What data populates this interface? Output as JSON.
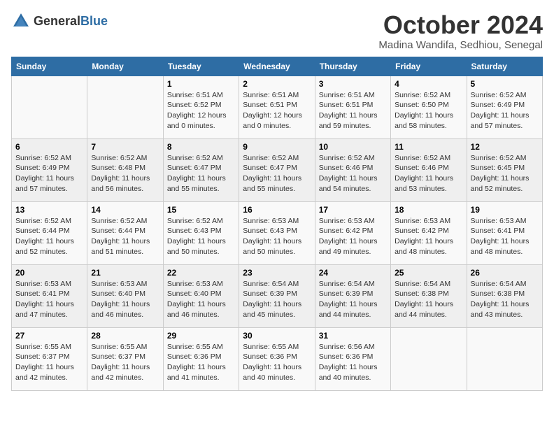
{
  "logo": {
    "general": "General",
    "blue": "Blue"
  },
  "title": "October 2024",
  "location": "Madina Wandifa, Sedhiou, Senegal",
  "weekdays": [
    "Sunday",
    "Monday",
    "Tuesday",
    "Wednesday",
    "Thursday",
    "Friday",
    "Saturday"
  ],
  "weeks": [
    [
      {
        "day": "",
        "content": ""
      },
      {
        "day": "",
        "content": ""
      },
      {
        "day": "1",
        "content": "Sunrise: 6:51 AM\nSunset: 6:52 PM\nDaylight: 12 hours\nand 0 minutes."
      },
      {
        "day": "2",
        "content": "Sunrise: 6:51 AM\nSunset: 6:51 PM\nDaylight: 12 hours\nand 0 minutes."
      },
      {
        "day": "3",
        "content": "Sunrise: 6:51 AM\nSunset: 6:51 PM\nDaylight: 11 hours\nand 59 minutes."
      },
      {
        "day": "4",
        "content": "Sunrise: 6:52 AM\nSunset: 6:50 PM\nDaylight: 11 hours\nand 58 minutes."
      },
      {
        "day": "5",
        "content": "Sunrise: 6:52 AM\nSunset: 6:49 PM\nDaylight: 11 hours\nand 57 minutes."
      }
    ],
    [
      {
        "day": "6",
        "content": "Sunrise: 6:52 AM\nSunset: 6:49 PM\nDaylight: 11 hours\nand 57 minutes."
      },
      {
        "day": "7",
        "content": "Sunrise: 6:52 AM\nSunset: 6:48 PM\nDaylight: 11 hours\nand 56 minutes."
      },
      {
        "day": "8",
        "content": "Sunrise: 6:52 AM\nSunset: 6:47 PM\nDaylight: 11 hours\nand 55 minutes."
      },
      {
        "day": "9",
        "content": "Sunrise: 6:52 AM\nSunset: 6:47 PM\nDaylight: 11 hours\nand 55 minutes."
      },
      {
        "day": "10",
        "content": "Sunrise: 6:52 AM\nSunset: 6:46 PM\nDaylight: 11 hours\nand 54 minutes."
      },
      {
        "day": "11",
        "content": "Sunrise: 6:52 AM\nSunset: 6:46 PM\nDaylight: 11 hours\nand 53 minutes."
      },
      {
        "day": "12",
        "content": "Sunrise: 6:52 AM\nSunset: 6:45 PM\nDaylight: 11 hours\nand 52 minutes."
      }
    ],
    [
      {
        "day": "13",
        "content": "Sunrise: 6:52 AM\nSunset: 6:44 PM\nDaylight: 11 hours\nand 52 minutes."
      },
      {
        "day": "14",
        "content": "Sunrise: 6:52 AM\nSunset: 6:44 PM\nDaylight: 11 hours\nand 51 minutes."
      },
      {
        "day": "15",
        "content": "Sunrise: 6:52 AM\nSunset: 6:43 PM\nDaylight: 11 hours\nand 50 minutes."
      },
      {
        "day": "16",
        "content": "Sunrise: 6:53 AM\nSunset: 6:43 PM\nDaylight: 11 hours\nand 50 minutes."
      },
      {
        "day": "17",
        "content": "Sunrise: 6:53 AM\nSunset: 6:42 PM\nDaylight: 11 hours\nand 49 minutes."
      },
      {
        "day": "18",
        "content": "Sunrise: 6:53 AM\nSunset: 6:42 PM\nDaylight: 11 hours\nand 48 minutes."
      },
      {
        "day": "19",
        "content": "Sunrise: 6:53 AM\nSunset: 6:41 PM\nDaylight: 11 hours\nand 48 minutes."
      }
    ],
    [
      {
        "day": "20",
        "content": "Sunrise: 6:53 AM\nSunset: 6:41 PM\nDaylight: 11 hours\nand 47 minutes."
      },
      {
        "day": "21",
        "content": "Sunrise: 6:53 AM\nSunset: 6:40 PM\nDaylight: 11 hours\nand 46 minutes."
      },
      {
        "day": "22",
        "content": "Sunrise: 6:53 AM\nSunset: 6:40 PM\nDaylight: 11 hours\nand 46 minutes."
      },
      {
        "day": "23",
        "content": "Sunrise: 6:54 AM\nSunset: 6:39 PM\nDaylight: 11 hours\nand 45 minutes."
      },
      {
        "day": "24",
        "content": "Sunrise: 6:54 AM\nSunset: 6:39 PM\nDaylight: 11 hours\nand 44 minutes."
      },
      {
        "day": "25",
        "content": "Sunrise: 6:54 AM\nSunset: 6:38 PM\nDaylight: 11 hours\nand 44 minutes."
      },
      {
        "day": "26",
        "content": "Sunrise: 6:54 AM\nSunset: 6:38 PM\nDaylight: 11 hours\nand 43 minutes."
      }
    ],
    [
      {
        "day": "27",
        "content": "Sunrise: 6:55 AM\nSunset: 6:37 PM\nDaylight: 11 hours\nand 42 minutes."
      },
      {
        "day": "28",
        "content": "Sunrise: 6:55 AM\nSunset: 6:37 PM\nDaylight: 11 hours\nand 42 minutes."
      },
      {
        "day": "29",
        "content": "Sunrise: 6:55 AM\nSunset: 6:36 PM\nDaylight: 11 hours\nand 41 minutes."
      },
      {
        "day": "30",
        "content": "Sunrise: 6:55 AM\nSunset: 6:36 PM\nDaylight: 11 hours\nand 40 minutes."
      },
      {
        "day": "31",
        "content": "Sunrise: 6:56 AM\nSunset: 6:36 PM\nDaylight: 11 hours\nand 40 minutes."
      },
      {
        "day": "",
        "content": ""
      },
      {
        "day": "",
        "content": ""
      }
    ]
  ]
}
